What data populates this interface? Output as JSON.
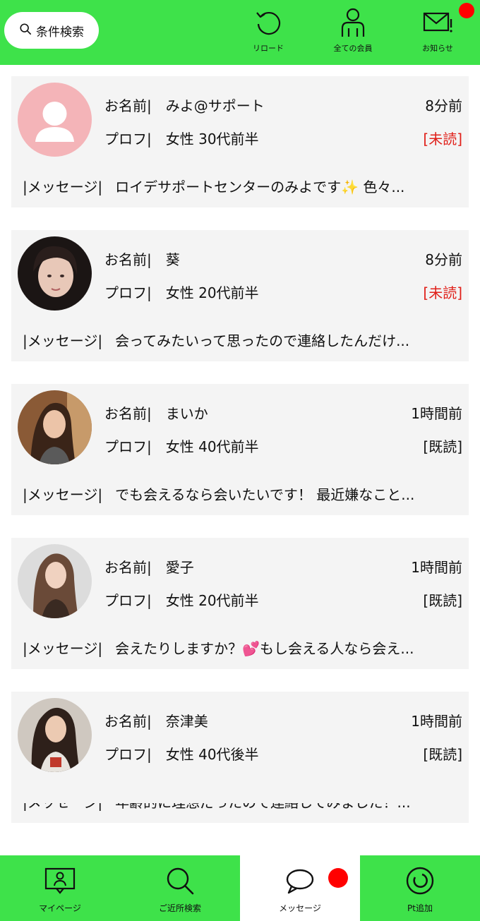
{
  "header": {
    "search_label": "条件検索",
    "reload_label": "リロード",
    "all_members_label": "全ての会員",
    "notice_label": "お知らせ"
  },
  "messages": [
    {
      "name_key": "お名前|",
      "name": "みよ@サポート",
      "time": "8分前",
      "prof_key": "プロフ|",
      "prof": "女性 30代前半",
      "status": "[未読]",
      "msg_key": "|メッセージ|",
      "msg": "ロイデサポートセンターのみよです✨ 色々..."
    },
    {
      "name_key": "お名前|",
      "name": "葵",
      "time": "8分前",
      "prof_key": "プロフ|",
      "prof": "女性 20代前半",
      "status": "[未読]",
      "msg_key": "|メッセージ|",
      "msg": "会ってみたいって思ったので連絡したんだけ..."
    },
    {
      "name_key": "お名前|",
      "name": "まいか",
      "time": "1時間前",
      "prof_key": "プロフ|",
      "prof": "女性 40代前半",
      "status": "[既読]",
      "msg_key": "|メッセージ|",
      "msg": "でも会えるなら会いたいです！ 最近嫌なこと..."
    },
    {
      "name_key": "お名前|",
      "name": "愛子",
      "time": "1時間前",
      "prof_key": "プロフ|",
      "prof": "女性 20代前半",
      "status": "[既読]",
      "msg_key": "|メッセージ|",
      "msg": "会えたりしますか？💕もし会える人なら会え..."
    },
    {
      "name_key": "お名前|",
      "name": "奈津美",
      "time": "1時間前",
      "prof_key": "プロフ|",
      "prof": "女性 40代後半",
      "status": "[既読]",
      "msg_key": "|メッセージ|",
      "msg": "年齢的に理想だったので連絡してみました！..."
    }
  ],
  "nav": {
    "mypage_label": "マイページ",
    "nearby_label": "ご近所検索",
    "messages_label": "メッセージ",
    "pt_label": "Pt追加"
  },
  "colors": {
    "brand": "#3ee24a",
    "unread": "#e0201a",
    "card_bg": "#f4f4f4",
    "badge": "#ff0000"
  },
  "icons": [
    "search-icon",
    "reload-icon",
    "members-icon",
    "mail-icon",
    "profile-card-icon",
    "nearby-search-icon",
    "chat-icon",
    "points-icon"
  ]
}
